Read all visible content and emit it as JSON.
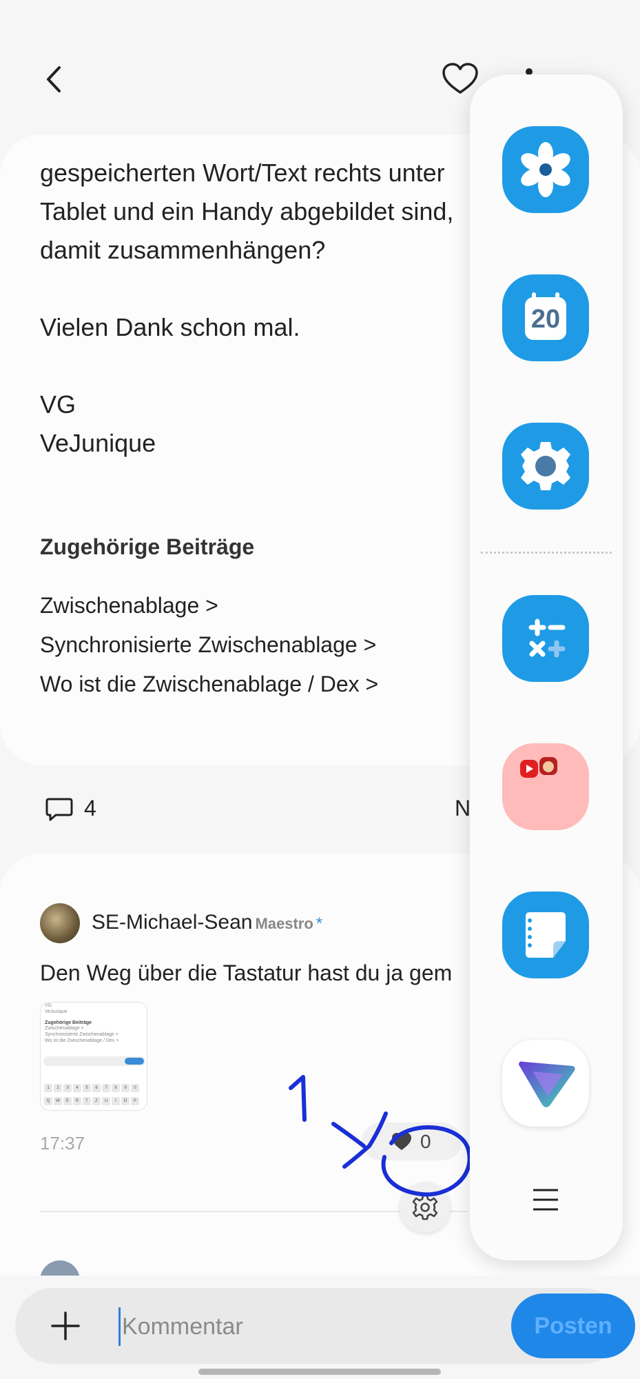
{
  "post": {
    "lines": [
      "gespeicherten Wort/Text rechts unter",
      "Tablet und ein Handy abgebildet sind,",
      "damit zusammenhängen?",
      "Vielen Dank schon mal.",
      "VG",
      "VeJunique"
    ],
    "related_title": "Zugehörige Beiträge",
    "related": [
      "Zwischenablage >",
      "Synchronisierte Zwischenablage >",
      "Wo ist die Zwischenablage / Dex >"
    ]
  },
  "summary": {
    "comment_count": "4",
    "sort_fragment": "N"
  },
  "comment": {
    "author": "SE-Michael-Sean",
    "rank": "Maestro",
    "star": "*",
    "text": "Den Weg über die Tastatur hast du ja gem",
    "thumbnail": {
      "line1": "VG",
      "line2": "VeJunique",
      "title": "Zugehörige Beiträge",
      "items": [
        "Zwischenablage >",
        "Synchronisierte Zwischenablage >",
        "Wo ist die Zwischenablage / Dex >"
      ],
      "bar_text": "Kommentar",
      "bar_button": "Posten",
      "keys": [
        "1",
        "2",
        "3",
        "4",
        "5",
        "6",
        "7",
        "8",
        "9",
        "0",
        "Q",
        "W",
        "E",
        "R",
        "T",
        "Z",
        "U",
        "I",
        "O",
        "P"
      ]
    },
    "time": "17:37",
    "likes": "0"
  },
  "annotation": {
    "number": "1"
  },
  "composer": {
    "placeholder": "Kommentar",
    "post_label": "Posten"
  },
  "edge_panel": {
    "apps": [
      "gallery-icon",
      "calendar-icon",
      "settings-icon",
      "calculator-icon",
      "folder-icon",
      "notes-icon",
      "vpn-icon"
    ],
    "calendar_day": "20"
  },
  "colors": {
    "accent": "#1f87e8",
    "edge_app_blue": "#1f9be6",
    "folder_pink": "#ffbaba",
    "annotation_ink": "#1a2fd6"
  }
}
